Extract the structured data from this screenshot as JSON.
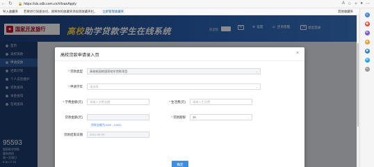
{
  "browser": {
    "url": "https://sls.cdb.com.cn/#/loanApply",
    "favorites_bar": {
      "import_label": "导入收藏夹",
      "warning": "若要进行快速访问，请将你的收藏夹添加到收藏夹栏。",
      "manage_link": "立即管理收藏夹",
      "other_favorites": "其他收藏夹"
    }
  },
  "site": {
    "logo_text": "国家开发银行",
    "logo_sub": "CHINA DEVELOPMENT BANK",
    "title_prefix": "高校",
    "title_rest": "助学贷款学生在线系统",
    "user_label": "欢迎您",
    "nav": [
      {
        "label": "站内信",
        "icon": "mail-icon"
      },
      {
        "label": "设置",
        "icon": "gear-icon"
      },
      {
        "label": "咨询客服",
        "icon": "chat-icon"
      },
      {
        "label": "退出登录",
        "icon": "logout-icon"
      }
    ],
    "sidebar": [
      {
        "label": "首页",
        "active": false
      },
      {
        "label": "高校资助",
        "active": false
      },
      {
        "label": "申请贷款",
        "active": true
      },
      {
        "label": "还款计划",
        "active": false
      },
      {
        "label": "个人信息维护",
        "active": false
      },
      {
        "label": "贷款查询",
        "active": false
      },
      {
        "label": "本金查询",
        "active": false
      },
      {
        "label": "在线查询",
        "active": false
      }
    ],
    "hotline": {
      "number": "95593",
      "line1": "国家助学贷款",
      "line2": "服务热线",
      "line3": "周一至周日",
      "line4": "8:30-17:30"
    }
  },
  "modal": {
    "title": "高校贷款申请录入页",
    "close": "×",
    "fields": {
      "loan_type": {
        "label": "贷款类型",
        "value": "高校校园地国家助学贷款项目"
      },
      "apply_year": {
        "label": "申请学年",
        "placeholder": "请选择"
      },
      "tuition": {
        "label": "学费金额(元)",
        "placeholder": "请输入学费金额"
      },
      "living": {
        "label": "生活费(元)",
        "placeholder": "请输入生活费"
      },
      "loan_amount": {
        "label": "贷款金额(元)",
        "placeholder": ""
      },
      "loan_term": {
        "label": "贷款期限",
        "value": "16"
      },
      "amount_hint": "贷款金额为1000 - 12000",
      "end_date": {
        "label": "贷款结束日期",
        "value": "2041-09-20"
      }
    },
    "confirm_label": "确定"
  }
}
